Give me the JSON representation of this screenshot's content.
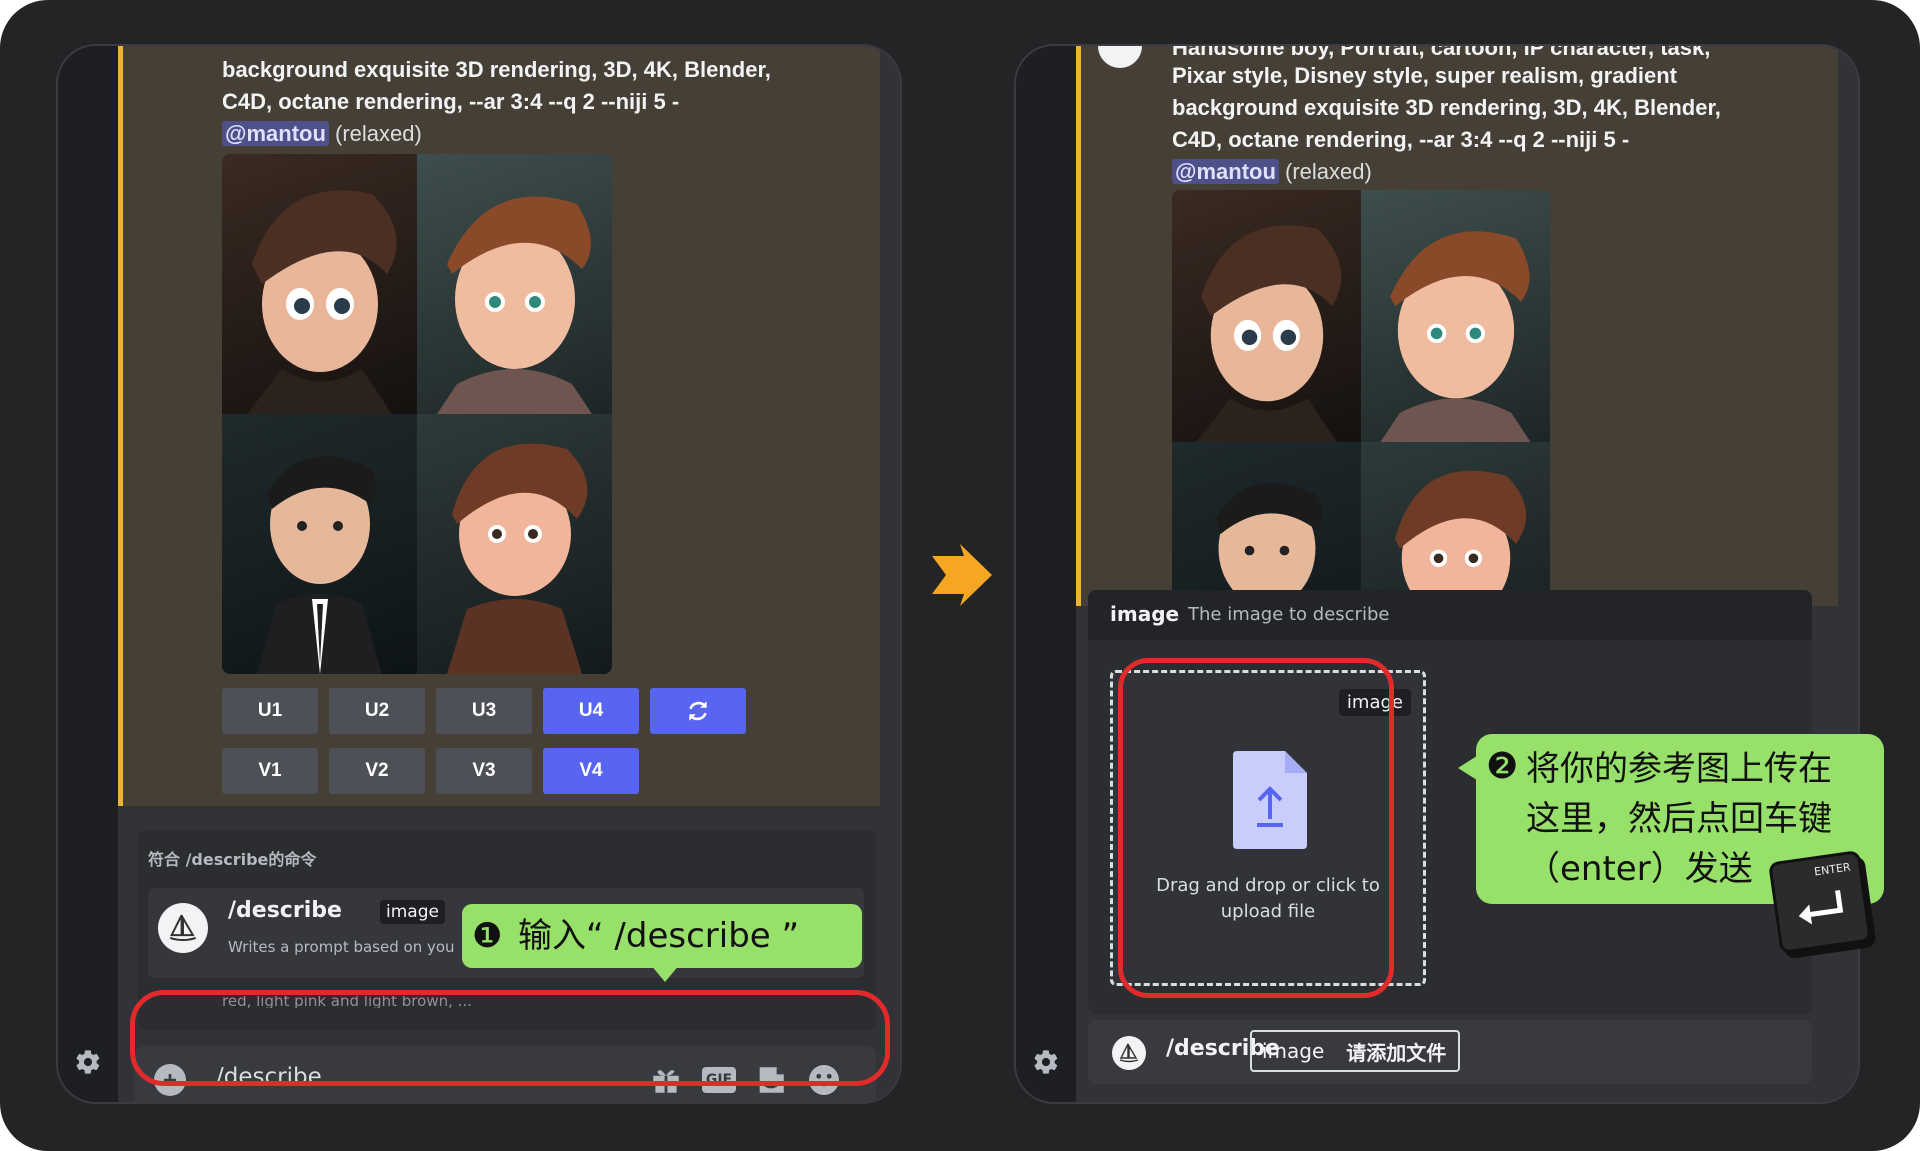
{
  "left": {
    "prompt_lines": [
      "background exquisite 3D rendering, 3D, 4K, Blender,",
      "C4D, octane rendering,    --ar 3:4 --q 2 --niji 5 -"
    ],
    "mention": "@mantou",
    "mode": "(relaxed)",
    "buttons_row1": [
      "U1",
      "U2",
      "U3",
      "U4"
    ],
    "buttons_row2": [
      "V1",
      "V2",
      "V3",
      "V4"
    ],
    "refresh_icon": "refresh-icon",
    "cmd_header": "符合 /describe的命令",
    "cmd_name": "/describe",
    "cmd_param": "image",
    "cmd_desc": "Writes a prompt based on you",
    "overflow_text": "red, light pink and light brown, ...",
    "input_value": "/describe",
    "icons": [
      "add-icon",
      "gift-icon",
      "gif-icon",
      "sticker-icon",
      "emoji-icon"
    ],
    "gif_label": "GIF",
    "callout1": "输入“ /describe ”",
    "callout1_num": "❶"
  },
  "right": {
    "prompt_lines": [
      "Handsome boy, Portrait, cartoon, IP character, task,",
      "Pixar style, Disney style, super realism, gradient",
      "background exquisite 3D rendering, 3D, 4K, Blender,",
      "C4D, octane rendering,    --ar 3:4 --q 2 --niji 5 -"
    ],
    "mention": "@mantou",
    "mode": "(relaxed)",
    "option_name": "image",
    "option_desc": "The image to describe",
    "upload_tag": "image",
    "upload_text_1": "Drag and drop or click to",
    "upload_text_2": "upload file",
    "cmd_name": "/describe",
    "param_label": "image",
    "param_placeholder": "请添加文件",
    "callout2_num": "❷",
    "callout2_lines": [
      "将你的参考图上传在",
      "这里，然后点回车键",
      "（enter）发送"
    ],
    "enter_key_label": "ENTER"
  },
  "colors": {
    "accent": "#5865f2",
    "highlight_red": "#e12b2b",
    "callout_green": "#97e06a",
    "embed_bar": "#f0b232",
    "arrow_orange": "#f5a623"
  }
}
